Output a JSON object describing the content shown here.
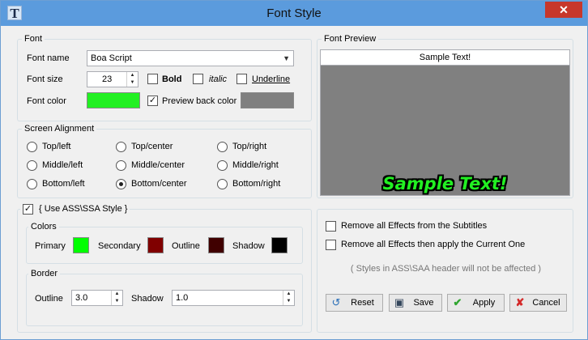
{
  "window": {
    "title": "Font Style",
    "close_symbol": "✕",
    "icon": "app-icon"
  },
  "font": {
    "legend": "Font",
    "name_label": "Font name",
    "name_value": "Boa Script",
    "size_label": "Font size",
    "size_value": "23",
    "bold_label": "Bold",
    "italic_label": "italic",
    "underline_label": "Underline",
    "color_label": "Font color",
    "color": "#22f022",
    "preview_back_label": "Preview back color",
    "preview_back_color": "#808080"
  },
  "alignment": {
    "legend": "Screen Alignment",
    "options": [
      {
        "label": "Top/left",
        "selected": false
      },
      {
        "label": "Top/center",
        "selected": false
      },
      {
        "label": "Top/right",
        "selected": false
      },
      {
        "label": "Middle/left",
        "selected": false
      },
      {
        "label": "Middle/center",
        "selected": false
      },
      {
        "label": "Middle/right",
        "selected": false
      },
      {
        "label": "Bottom/left",
        "selected": false
      },
      {
        "label": "Bottom/center",
        "selected": true
      },
      {
        "label": "Bottom/right",
        "selected": false
      }
    ]
  },
  "preview": {
    "legend": "Font Preview",
    "header_text": "Sample Text!",
    "sample_text": "Sample Text!"
  },
  "ass": {
    "legend": "{ Use ASS\\SSA Style }",
    "colors_legend": "Colors",
    "primary_label": "Primary",
    "primary_color": "#00ff00",
    "secondary_label": "Secondary",
    "secondary_color": "#800000",
    "outline_label": "Outline",
    "outline_color": "#400000",
    "shadow_label": "Shadow",
    "shadow_color": "#000000",
    "border_legend": "Border",
    "border_outline_label": "Outline",
    "border_outline_value": "3.0",
    "border_shadow_label": "Shadow",
    "border_shadow_value": "1.0"
  },
  "effects": {
    "remove_all_label": "Remove all Effects from the Subtitles",
    "remove_apply_label": "Remove all Effects then apply the Current One",
    "note": "( Styles in ASS\\SAA header will not be affected )"
  },
  "buttons": {
    "reset": "Reset",
    "save": "Save",
    "apply": "Apply",
    "cancel": "Cancel"
  }
}
